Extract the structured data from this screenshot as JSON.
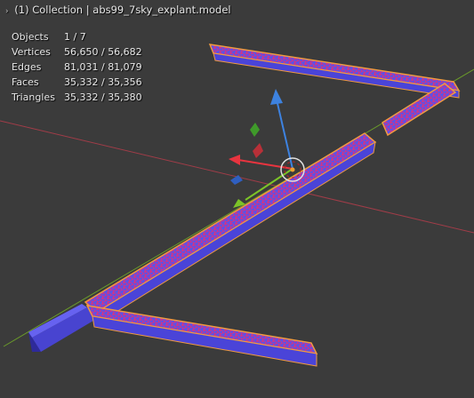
{
  "viewport": {
    "header_caret": "›",
    "collection_label": "(1) Collection | abs99_7sky_explant.model"
  },
  "stats": [
    {
      "label": "Objects",
      "value": "1 / 7"
    },
    {
      "label": "Vertices",
      "value": "56,650 / 56,682"
    },
    {
      "label": "Edges",
      "value": "81,031 / 81,079"
    },
    {
      "label": "Faces",
      "value": "35,332 / 35,356"
    },
    {
      "label": "Triangles",
      "value": "35,332 / 35,380"
    }
  ],
  "colors": {
    "background": "#3b3b3b",
    "x_axis": "#a03c48",
    "y_axis": "#6a9a2a",
    "mesh_face": "#5a52e8",
    "mesh_edge": "#e0307a",
    "selection_outline": "#f09a40",
    "gizmo_x": "#e8343f",
    "gizmo_y": "#7cc428",
    "gizmo_z": "#3d82e0"
  },
  "icons": {
    "move_gizmo": "transform-gizmo-icon",
    "cursor_3d": "3d-cursor-icon"
  }
}
